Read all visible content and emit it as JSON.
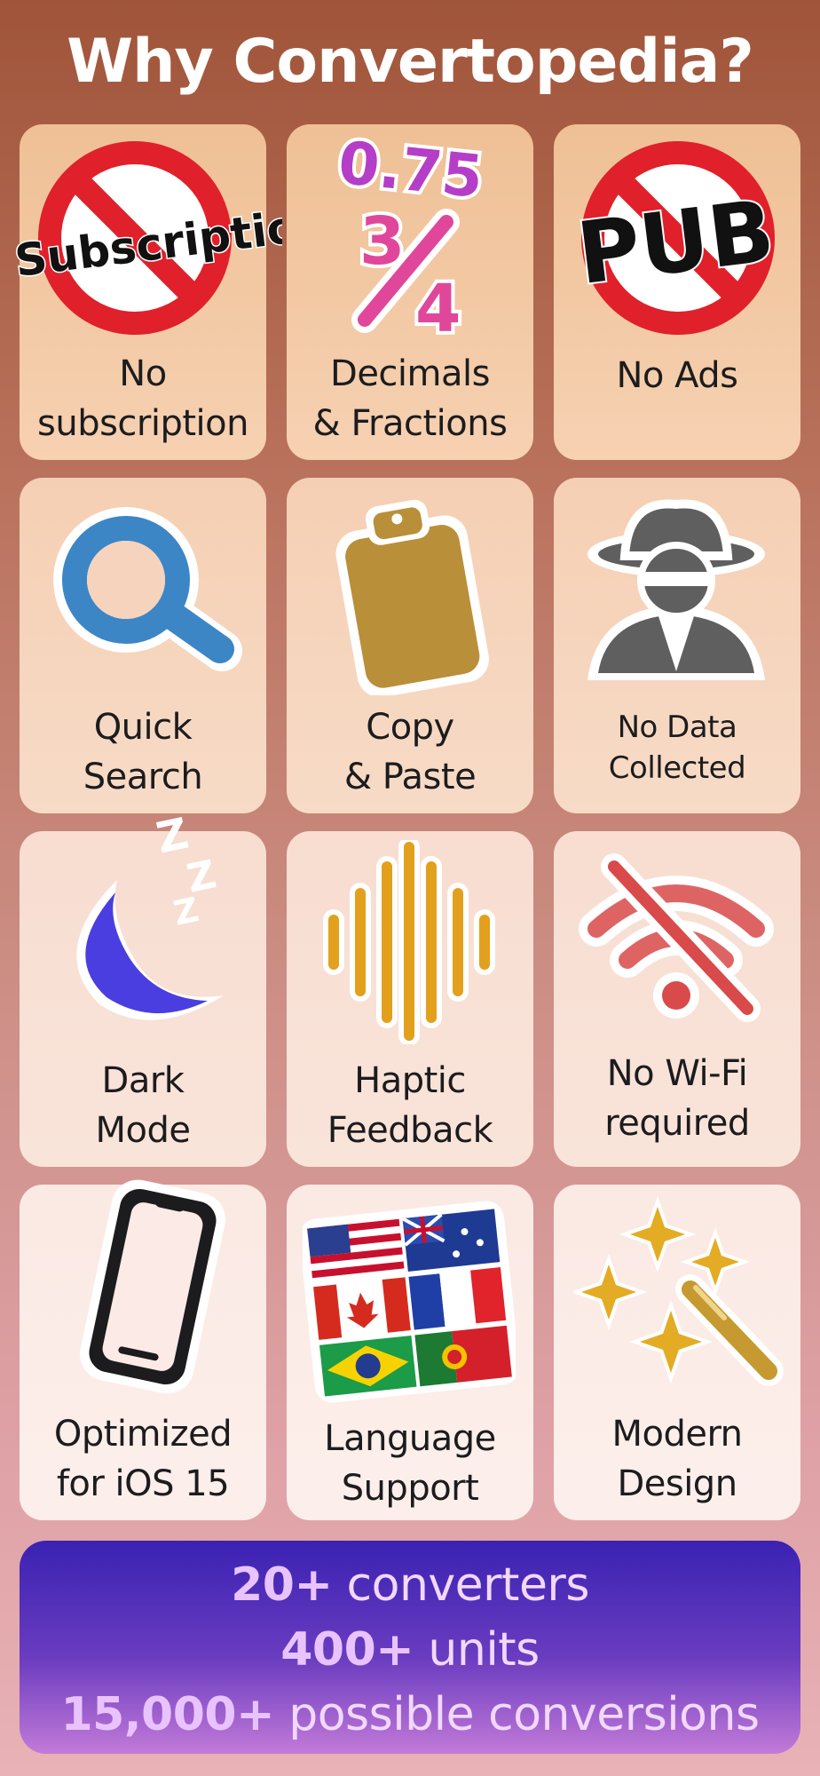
{
  "header": {
    "title": "Why Convertopedia?"
  },
  "features": [
    {
      "id": "no-subscription",
      "line1": "No",
      "line2": "subscription",
      "icon": "no-subscription-icon",
      "icon_text": "Subscription"
    },
    {
      "id": "decimals-fractions",
      "line1": "Decimals",
      "line2": "& Fractions",
      "icon": "decimal-fraction-icon",
      "icon_text_top": "0.75",
      "icon_text_num": "3",
      "icon_text_den": "4"
    },
    {
      "id": "no-ads",
      "line1": "No Ads",
      "line2": "",
      "icon": "no-ads-icon",
      "icon_text": "PUB"
    },
    {
      "id": "quick-search",
      "line1": "Quick",
      "line2": "Search",
      "icon": "magnifier-icon"
    },
    {
      "id": "copy-paste",
      "line1": "Copy",
      "line2": "& Paste",
      "icon": "clipboard-icon"
    },
    {
      "id": "no-data",
      "line1": "No Data",
      "line2": "Collected",
      "icon": "spy-icon"
    },
    {
      "id": "dark-mode",
      "line1": "Dark",
      "line2": "Mode",
      "icon": "moon-icon",
      "icon_text": "Z"
    },
    {
      "id": "haptic",
      "line1": "Haptic",
      "line2": "Feedback",
      "icon": "haptic-wave-icon"
    },
    {
      "id": "no-wifi",
      "line1": "No Wi-Fi",
      "line2": "required",
      "icon": "no-wifi-icon"
    },
    {
      "id": "ios15",
      "line1": "Optimized",
      "line2": "for iOS 15",
      "icon": "phone-icon"
    },
    {
      "id": "language",
      "line1": "Language",
      "line2": "Support",
      "icon": "flags-icon"
    },
    {
      "id": "modern",
      "line1": "Modern",
      "line2": "Design",
      "icon": "sparkles-wand-icon"
    }
  ],
  "stats": {
    "line1_num": "20+",
    "line1_text": "converters",
    "line2_num": "400+",
    "line2_text": "units",
    "line3_num": "15,000+",
    "line3_text": "possible conversions"
  },
  "colors": {
    "prohibition_red": "#e0202a",
    "fraction_purple": "#b53ec8",
    "fraction_pink": "#e0479a",
    "search_blue": "#3d86c6",
    "clipboard_gold": "#b98f3a",
    "spy_gray": "#5f5f5f",
    "moon_indigo": "#4a3ee0",
    "haptic_amber": "#e2a01c",
    "wifi_red": "#d94a4a",
    "sparkle_gold": "#e3ac24"
  }
}
